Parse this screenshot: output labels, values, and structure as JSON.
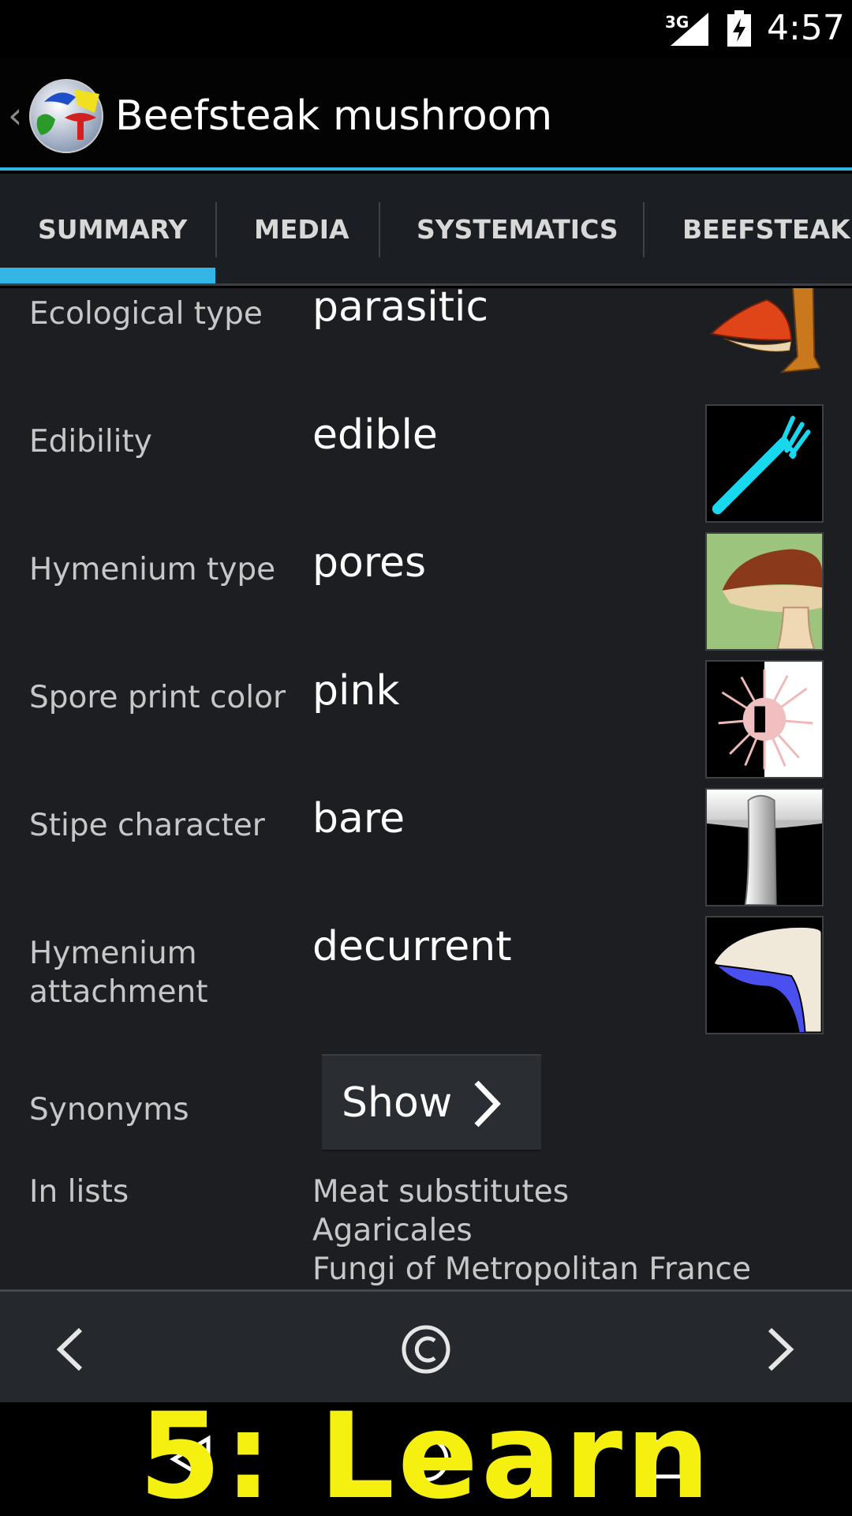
{
  "status_bar": {
    "network": "3G",
    "time": "4:57"
  },
  "action_bar": {
    "title": "Beefsteak mushroom"
  },
  "tabs": [
    {
      "label": "SUMMARY",
      "selected": true
    },
    {
      "label": "MEDIA",
      "selected": false
    },
    {
      "label": "SYSTEMATICS",
      "selected": false
    },
    {
      "label": "BEEFSTEAK M",
      "selected": false
    }
  ],
  "traits": [
    {
      "label": "Ecological type",
      "value": "parasitic",
      "icon": "parasitic-icon"
    },
    {
      "label": "Edibility",
      "value": "edible",
      "icon": "fork-icon"
    },
    {
      "label": "Hymenium type",
      "value": "pores",
      "icon": "pores-icon"
    },
    {
      "label": "Spore print color",
      "value": "pink",
      "icon": "spore-print-icon"
    },
    {
      "label": "Stipe character",
      "value": "bare",
      "icon": "bare-stipe-icon"
    },
    {
      "label": "Hymenium attachment",
      "value": "decurrent",
      "icon": "decurrent-icon"
    }
  ],
  "synonyms": {
    "label": "Synonyms",
    "button_label": "Show"
  },
  "in_lists": {
    "label": "In lists",
    "items": [
      "Meat substitutes",
      "Agaricales",
      "Fungi of Metropolitan France"
    ]
  },
  "bottom_bar": {
    "copyright_symbol": "©"
  },
  "overlay": {
    "caption": "5: Learn"
  },
  "colors": {
    "accent": "#33b5e5",
    "background": "#1c1e22",
    "caption": "#f5f010"
  }
}
